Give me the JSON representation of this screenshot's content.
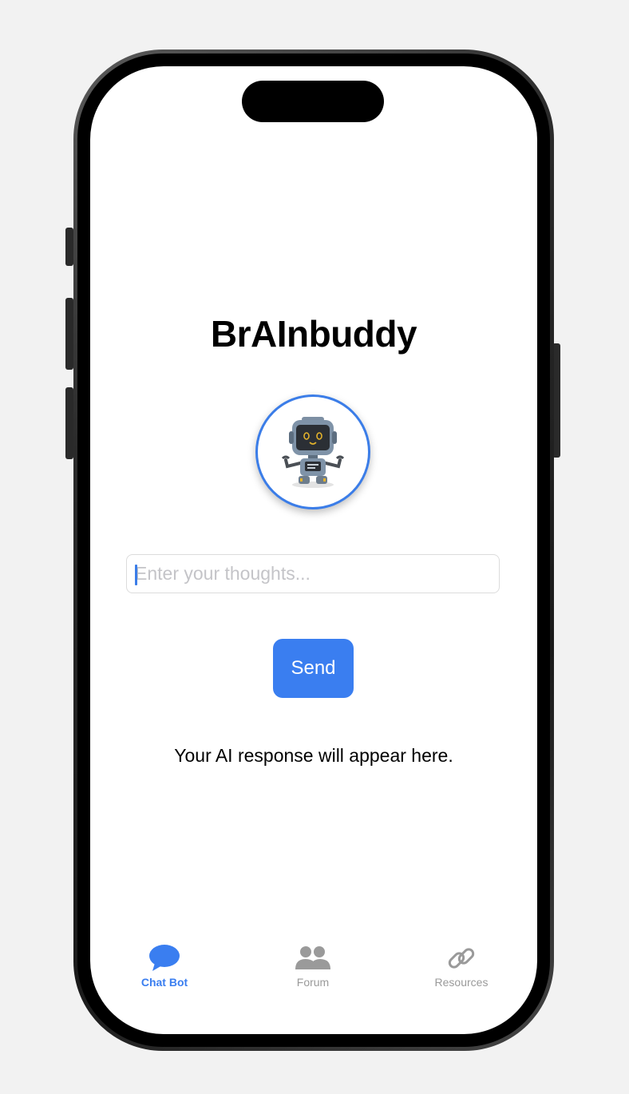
{
  "app": {
    "title": "BrAInbuddy"
  },
  "chat": {
    "input_placeholder": "Enter your thoughts...",
    "input_value": "",
    "send_label": "Send",
    "response_text": "Your AI response will appear here."
  },
  "tabbar": {
    "active": "Chat Bot",
    "items": [
      {
        "label": "Chat Bot",
        "icon": "chat-bubble-icon"
      },
      {
        "label": "Forum",
        "icon": "people-icon"
      },
      {
        "label": "Resources",
        "icon": "link-icon"
      }
    ]
  },
  "colors": {
    "accent": "#3a7ef0",
    "inactive_tab": "#9a9a9a",
    "background": "#ffffff"
  }
}
